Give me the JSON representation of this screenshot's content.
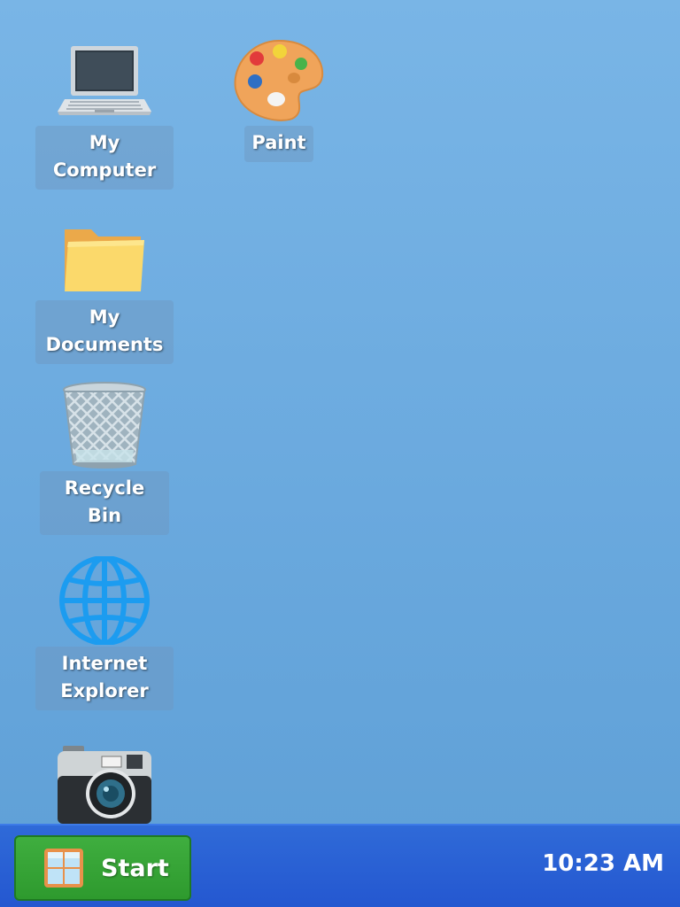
{
  "desktop": {
    "icons": [
      {
        "label": "My\nComputer",
        "icon": "laptop-icon"
      },
      {
        "label": "Paint",
        "icon": "palette-icon"
      },
      {
        "label": "My\nDocuments",
        "icon": "folder-icon"
      },
      {
        "label": "Recycle Bin",
        "icon": "recycle-bin-icon"
      },
      {
        "label": "Internet\nExplorer",
        "icon": "globe-icon"
      },
      {
        "label": "",
        "icon": "camera-icon"
      }
    ]
  },
  "taskbar": {
    "start_label": "Start",
    "clock": "10:23 AM"
  },
  "colors": {
    "desktop": "#6aa9de",
    "taskbar": "#2457d0",
    "start_button": "#2e9a2e"
  }
}
